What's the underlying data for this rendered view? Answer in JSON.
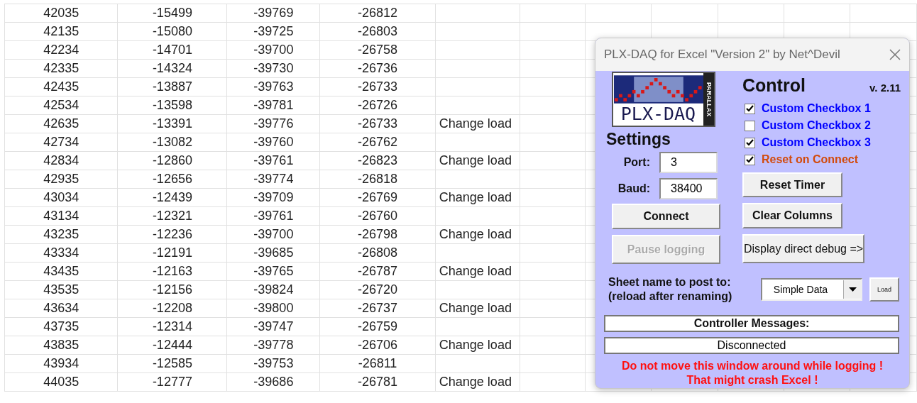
{
  "sheet": {
    "rows": [
      [
        "42035",
        "-15499",
        "-39769",
        "-26812",
        ""
      ],
      [
        "42135",
        "-15080",
        "-39725",
        "-26803",
        ""
      ],
      [
        "42234",
        "-14701",
        "-39700",
        "-26758",
        ""
      ],
      [
        "42335",
        "-14324",
        "-39730",
        "-26736",
        ""
      ],
      [
        "42435",
        "-13887",
        "-39763",
        "-26733",
        ""
      ],
      [
        "42534",
        "-13598",
        "-39781",
        "-26726",
        ""
      ],
      [
        "42635",
        "-13391",
        "-39776",
        "-26733",
        "Change load"
      ],
      [
        "42734",
        "-13082",
        "-39760",
        "-26762",
        ""
      ],
      [
        "42834",
        "-12860",
        "-39761",
        "-26823",
        "Change load"
      ],
      [
        "42935",
        "-12656",
        "-39774",
        "-26818",
        ""
      ],
      [
        "43034",
        "-12439",
        "-39709",
        "-26769",
        "Change load"
      ],
      [
        "43134",
        "-12321",
        "-39761",
        "-26760",
        ""
      ],
      [
        "43235",
        "-12236",
        "-39700",
        "-26798",
        "Change load"
      ],
      [
        "43334",
        "-12191",
        "-39685",
        "-26808",
        ""
      ],
      [
        "43435",
        "-12163",
        "-39765",
        "-26787",
        "Change load"
      ],
      [
        "43535",
        "-12156",
        "-39824",
        "-26720",
        ""
      ],
      [
        "43634",
        "-12208",
        "-39800",
        "-26737",
        "Change load"
      ],
      [
        "43735",
        "-12314",
        "-39747",
        "-26759",
        ""
      ],
      [
        "43835",
        "-12444",
        "-39778",
        "-26706",
        "Change load"
      ],
      [
        "43934",
        "-12585",
        "-39753",
        "-26811",
        ""
      ],
      [
        "44035",
        "-12777",
        "-39686",
        "-26781",
        "Change load"
      ]
    ]
  },
  "dialog": {
    "title": "PLX-DAQ for Excel \"Version 2\" by Net^Devil",
    "logo": {
      "text": "PLX-DAQ",
      "side_text": "PARALLAX"
    },
    "settings": {
      "heading": "Settings",
      "port_label": "Port:",
      "port_value": "3",
      "baud_label": "Baud:",
      "baud_value": "38400"
    },
    "control": {
      "heading": "Control",
      "version": "v. 2.11"
    },
    "checkboxes": [
      {
        "label": "Custom Checkbox 1",
        "checked": true,
        "color": "#0000ff"
      },
      {
        "label": "Custom Checkbox 2",
        "checked": false,
        "color": "#0000ff"
      },
      {
        "label": "Custom Checkbox 3",
        "checked": true,
        "color": "#0000ff"
      },
      {
        "label": "Reset on Connect",
        "checked": true,
        "color": "#d24a0c"
      }
    ],
    "buttons": {
      "reset_timer": {
        "label": "Reset Timer",
        "disabled": false
      },
      "connect": {
        "label": "Connect",
        "disabled": false
      },
      "clear_columns": {
        "label": "Clear Columns",
        "disabled": false
      },
      "pause_logging": {
        "label": "Pause logging",
        "disabled": true
      },
      "debug": {
        "label": "Display direct debug =>",
        "disabled": false
      }
    },
    "sheet_select": {
      "label_line1": "Sheet name to post to:",
      "label_line2": "(reload after renaming)",
      "value": "Simple Data",
      "load_button": "Load"
    },
    "messages_heading": "Controller Messages:",
    "status": "Disconnected",
    "warning_line1": "Do not move this window around while logging !",
    "warning_line2": "That might crash Excel !"
  }
}
